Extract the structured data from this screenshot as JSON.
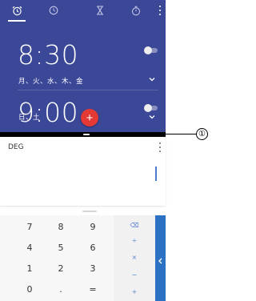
{
  "clock": {
    "tabs": [
      {
        "icon": "alarm-clock-icon"
      },
      {
        "icon": "clock-icon"
      },
      {
        "icon": "hourglass-icon"
      },
      {
        "icon": "stopwatch-icon"
      }
    ],
    "active_tab_index": 0,
    "more_icon": "more-vert-icon",
    "alarms": [
      {
        "time": "8:30",
        "days": "月、火、水、木、金",
        "enabled": false
      },
      {
        "time": "9:00",
        "days": "日、土",
        "enabled": false
      }
    ],
    "fab_label": "+",
    "colors": {
      "background": "#3b4797",
      "fab": "#e53935"
    }
  },
  "split_screen": {
    "callout_number": "①"
  },
  "calculator": {
    "mode": "DEG",
    "keypad": [
      [
        "7",
        "8",
        "9"
      ],
      [
        "4",
        "5",
        "6"
      ],
      [
        "1",
        "2",
        "3"
      ],
      [
        "0",
        ".",
        "="
      ]
    ],
    "operators": [
      "⌫",
      "÷",
      "×",
      "−",
      "+"
    ],
    "advanced_toggle_icon": "chevron-left-icon",
    "colors": {
      "accent": "#2d71c4",
      "operator_text": "#5b7fd6"
    }
  }
}
